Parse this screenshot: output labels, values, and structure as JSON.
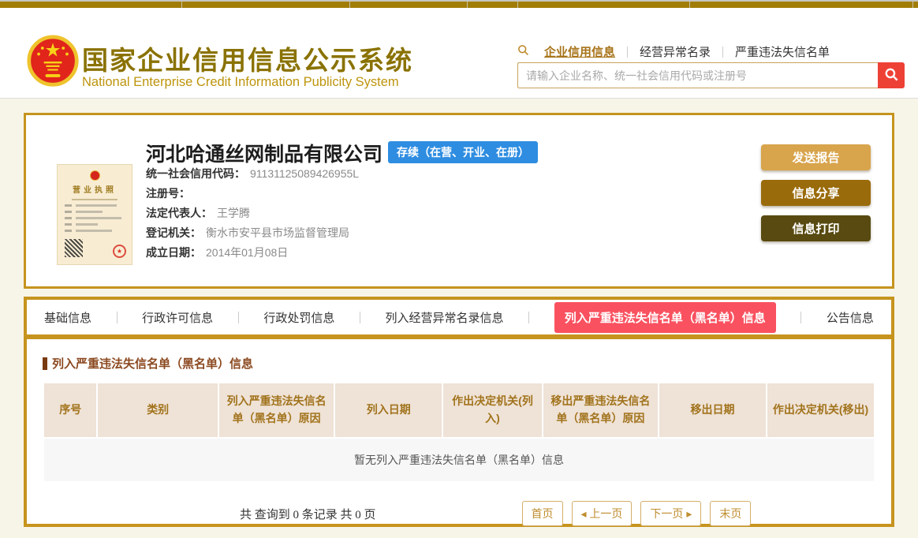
{
  "colors": {
    "page_bg": "#f7f5e8",
    "gold_border": "#c6941e",
    "topbar_gold": "#a17d08",
    "brand_title": "#8a7203",
    "brand_subtitle": "#bd940b",
    "nav_link_gold": "#a8741a",
    "search_button_red": "#ee4136",
    "status_badge_blue": "#2e8de1",
    "active_tab_red": "#f9515f",
    "table_header_bg": "#efe2d6",
    "table_header_text": "#a1731c",
    "section_title_brown": "#8c4a21",
    "btn_send_gold": "#d8a44c",
    "btn_share_brown": "#9a6b0b",
    "btn_print_dark": "#584a10"
  },
  "header": {
    "site_title": "国家企业信用信息公示系统",
    "site_subtitle": "National Enterprise Credit Information Publicity System",
    "nav": [
      {
        "label": "企业信用信息"
      },
      {
        "label": "经营异常名录"
      },
      {
        "label": "严重违法失信名单"
      }
    ],
    "search": {
      "placeholder": "请输入企业名称、统一社会信用代码或注册号",
      "value": ""
    }
  },
  "company": {
    "name": "河北哈通丝网制品有限公司",
    "status": "存续（在营、开业、在册）",
    "license_thumb": {
      "title": "营业执照"
    },
    "fields": [
      {
        "label": "统一社会信用代码：",
        "value": "91131125089426955L"
      },
      {
        "label": "注册号：",
        "value": ""
      },
      {
        "label": "法定代表人：",
        "value": "王学腾"
      },
      {
        "label": "登记机关：",
        "value": "衡水市安平县市场监督管理局"
      },
      {
        "label": "成立日期：",
        "value": "2014年01月08日"
      }
    ],
    "actions": [
      {
        "label": "发送报告"
      },
      {
        "label": "信息分享"
      },
      {
        "label": "信息打印"
      }
    ]
  },
  "tabs": [
    {
      "label": "基础信息",
      "active": false
    },
    {
      "label": "行政许可信息",
      "active": false
    },
    {
      "label": "行政处罚信息",
      "active": false
    },
    {
      "label": "列入经营异常名录信息",
      "active": false
    },
    {
      "label": "列入严重违法失信名单（黑名单）信息",
      "active": true
    },
    {
      "label": "公告信息",
      "active": false
    }
  ],
  "blacklist_section": {
    "title": "列入严重违法失信名单（黑名单）信息",
    "table_headers": [
      "序号",
      "类别",
      "列入严重违法失信名单（黑名单）原因",
      "列入日期",
      "作出决定机关(列入)",
      "移出严重违法失信名单（黑名单）原因",
      "移出日期",
      "作出决定机关(移出)"
    ],
    "empty_message": "暂无列入严重违法失信名单（黑名单）信息",
    "pagination": {
      "summary": "共 查询到 0 条记录 共 0 页",
      "first": "首页",
      "prev": "◂ 上一页",
      "next": "下一页 ▸",
      "last": "末页"
    }
  }
}
